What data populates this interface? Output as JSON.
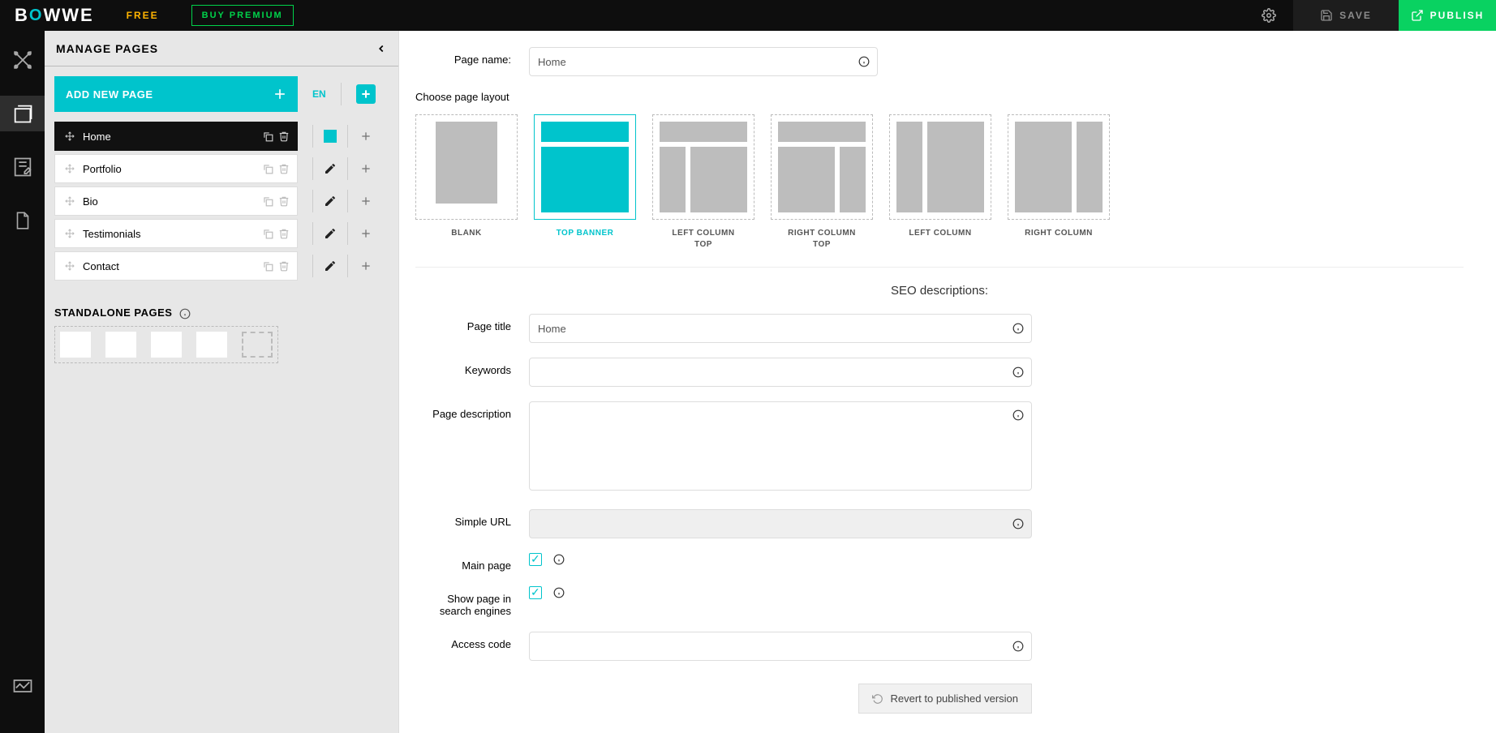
{
  "topbar": {
    "logo_left": "B",
    "logo_o": "O",
    "logo_right": "WWE",
    "free": "FREE",
    "buy": "BUY PREMIUM",
    "save": "SAVE",
    "publish": "PUBLISH"
  },
  "panel": {
    "title": "MANAGE PAGES",
    "add_label": "ADD NEW PAGE",
    "lang": "EN",
    "standalone_title": "STANDALONE PAGES"
  },
  "pages": [
    {
      "name": "Home",
      "selected": true
    },
    {
      "name": "Portfolio",
      "selected": false
    },
    {
      "name": "Bio",
      "selected": false
    },
    {
      "name": "Testimonials",
      "selected": false
    },
    {
      "name": "Contact",
      "selected": false
    }
  ],
  "form": {
    "page_name_label": "Page name:",
    "page_name_value": "Home",
    "choose_layout": "Choose page layout",
    "seo_heading": "SEO descriptions:",
    "page_title_label": "Page title",
    "page_title_value": "Home",
    "keywords_label": "Keywords",
    "keywords_value": "",
    "page_description_label": "Page description",
    "page_description_value": "",
    "simple_url_label": "Simple URL",
    "simple_url_value": "",
    "main_page_label": "Main page",
    "main_page_checked": true,
    "show_search_label_1": "Show page in",
    "show_search_label_2": "search engines",
    "show_search_checked": true,
    "access_code_label": "Access code",
    "access_code_value": "",
    "revert": "Revert to published version"
  },
  "layouts": [
    {
      "id": "blank",
      "label": "BLANK",
      "selected": false
    },
    {
      "id": "top_banner",
      "label": "TOP BANNER",
      "selected": true
    },
    {
      "id": "left_column_top",
      "label": "LEFT COLUMN TOP",
      "selected": false
    },
    {
      "id": "right_column_top",
      "label": "RIGHT COLUMN TOP",
      "selected": false
    },
    {
      "id": "left_column",
      "label": "LEFT COLUMN",
      "selected": false
    },
    {
      "id": "right_column",
      "label": "RIGHT COLUMN",
      "selected": false
    }
  ]
}
